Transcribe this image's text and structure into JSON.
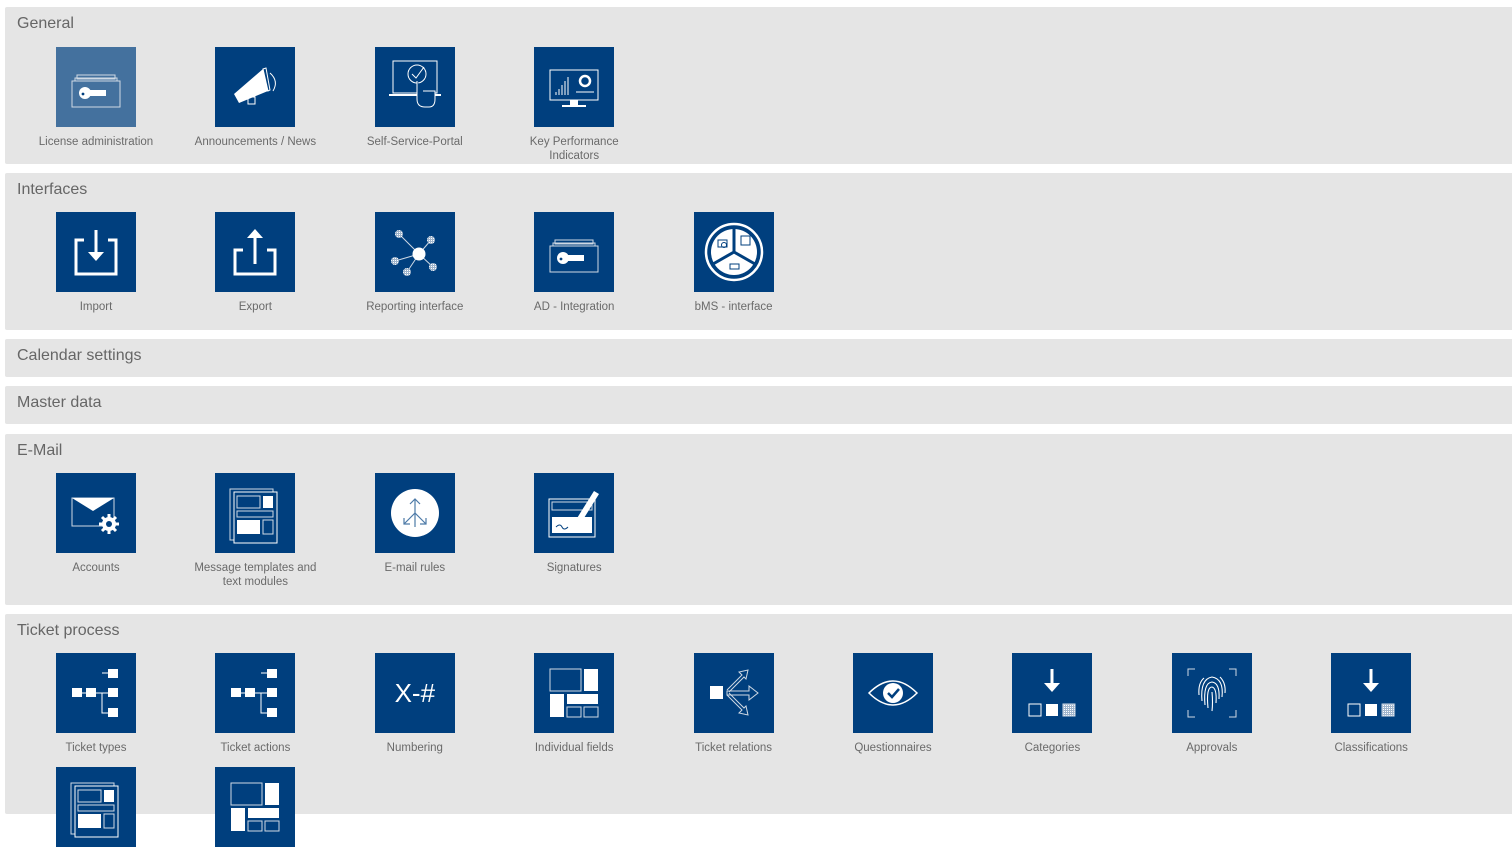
{
  "colors": {
    "panel_bg": "#e5e5e5",
    "tile_bg": "#003f7e",
    "tile_hover_bg": "#44719e",
    "label": "#6a6a6a",
    "title": "#666666"
  },
  "sections": [
    {
      "title": "General",
      "items": [
        {
          "label": "License administration",
          "icon": "license-key-icon",
          "hovered": true
        },
        {
          "label": "Announcements / News",
          "icon": "megaphone-icon"
        },
        {
          "label": "Self-Service-Portal",
          "icon": "touch-screen-icon"
        },
        {
          "label": "Key Performance Indicators",
          "icon": "kpi-monitor-icon"
        }
      ]
    },
    {
      "title": "Interfaces",
      "items": [
        {
          "label": "Import",
          "icon": "import-icon"
        },
        {
          "label": "Export",
          "icon": "export-icon"
        },
        {
          "label": "Reporting interface",
          "icon": "network-nodes-icon"
        },
        {
          "label": "AD - Integration",
          "icon": "license-key-icon"
        },
        {
          "label": "bMS - interface",
          "icon": "bms-circle-icon"
        }
      ]
    },
    {
      "title": "Calendar settings",
      "items": []
    },
    {
      "title": "Master data",
      "items": []
    },
    {
      "title": "E-Mail",
      "items": [
        {
          "label": "Accounts",
          "icon": "mail-gear-icon"
        },
        {
          "label": "Message templates and text modules",
          "icon": "templates-icon"
        },
        {
          "label": "E-mail rules",
          "icon": "mail-rules-icon"
        },
        {
          "label": "Signatures",
          "icon": "signature-icon"
        }
      ]
    },
    {
      "title": "Ticket process",
      "items": [
        {
          "label": "Ticket types",
          "icon": "flow-tree-icon"
        },
        {
          "label": "Ticket actions",
          "icon": "flow-tree-icon"
        },
        {
          "label": "Numbering",
          "icon": "numbering-icon",
          "glyph": "X-#"
        },
        {
          "label": "Individual fields",
          "icon": "layout-fields-icon"
        },
        {
          "label": "Ticket relations",
          "icon": "relations-arrows-icon"
        },
        {
          "label": "Questionnaires",
          "icon": "eye-check-icon"
        },
        {
          "label": "Categories",
          "icon": "category-arrow-icon"
        },
        {
          "label": "Approvals",
          "icon": "fingerprint-icon"
        },
        {
          "label": "Classifications",
          "icon": "category-arrow-icon"
        },
        {
          "label": "",
          "icon": "templates-icon"
        },
        {
          "label": "",
          "icon": "layout-fields-icon"
        }
      ]
    }
  ]
}
